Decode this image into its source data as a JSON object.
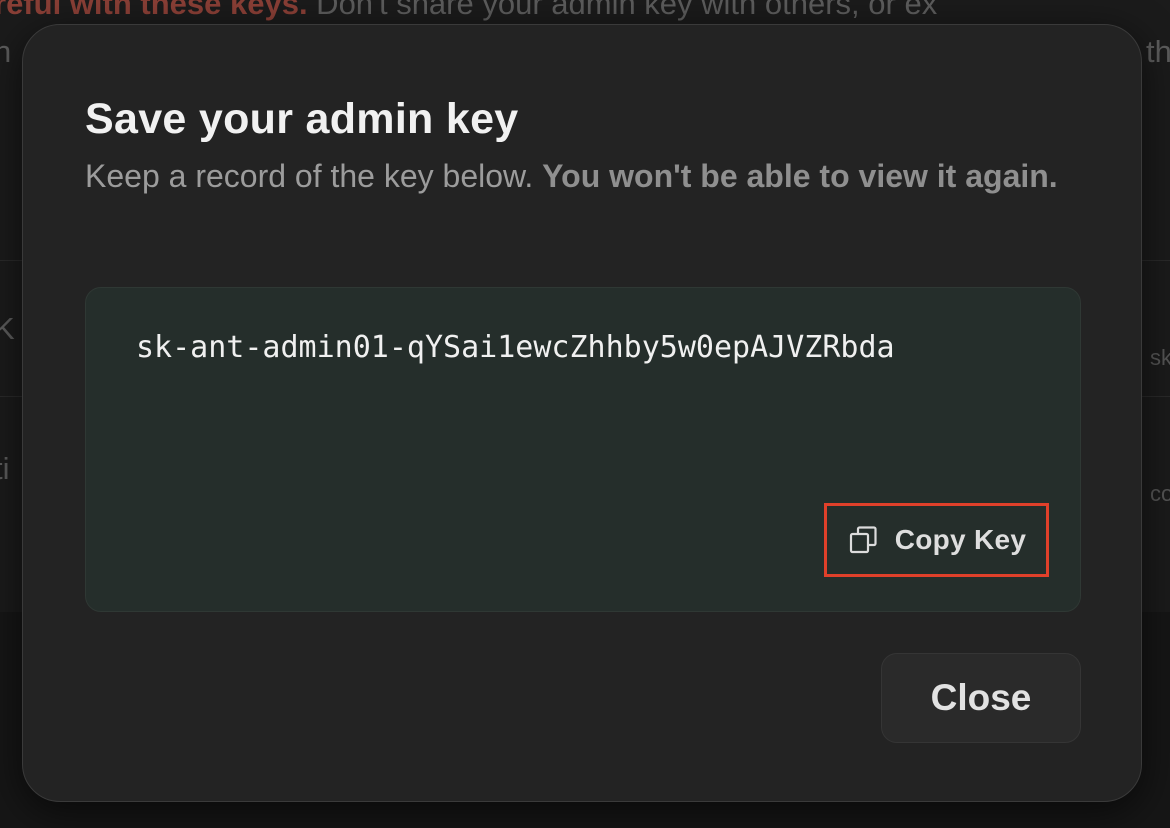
{
  "background": {
    "warning_strong": "reful with these keys.",
    "warning_rest": " Don't share your admin key with others, or ex",
    "line2_left": "n",
    "line2_right": "th",
    "row1_left": "K",
    "row1_right": "sko",
    "row2_left": "ti",
    "row2_right": "con"
  },
  "modal": {
    "title": "Save your admin key",
    "description_plain": "Keep a record of the key below. ",
    "description_strong": "You won't be able to view it again.",
    "key_value": "sk-ant-admin01-qYSai1ewcZhhby5w0epAJVZRbda",
    "copy_button_label": "Copy Key",
    "close_button_label": "Close",
    "copy_icon": "copy-icon"
  },
  "colors": {
    "highlight_border": "#e0402a",
    "key_box_bg": "#252e2b",
    "modal_bg": "#232323"
  }
}
